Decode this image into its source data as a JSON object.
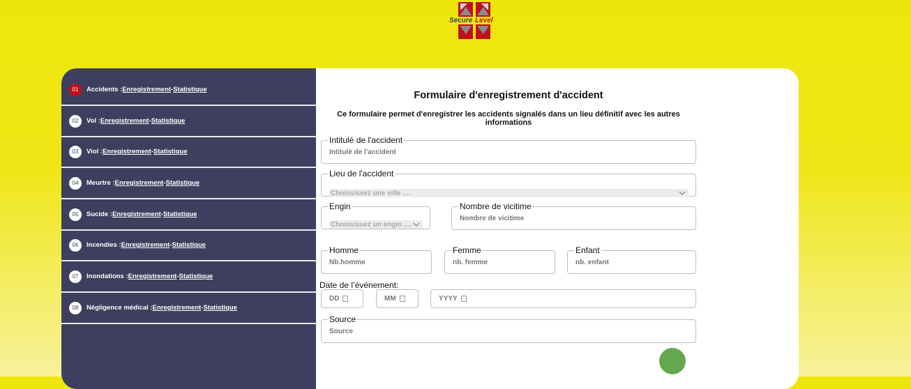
{
  "logo": {
    "text_1": "Secure",
    "text_2": "Level",
    "colors": {
      "red": "#c0101a",
      "grey": "#8a8a8a",
      "text_dark": "#3e3f5e"
    }
  },
  "sidebar": {
    "items": [
      {
        "num": "01",
        "label": "Accidents :",
        "link_1": "Enregistrement",
        "sep": "-",
        "link_2": "Statistique",
        "active": true
      },
      {
        "num": "02",
        "label": "Vol :",
        "link_1": "Enregistrement",
        "sep": "-",
        "link_2": "Statistique"
      },
      {
        "num": "03",
        "label": "Viol :",
        "link_1": "Enregistrement",
        "sep": "-",
        "link_2": "Statistique"
      },
      {
        "num": "04",
        "label": "Meurtre :",
        "link_1": "Enregistrement",
        "sep": "-",
        "link_2": "Statistique"
      },
      {
        "num": "05",
        "label": "Sucide :",
        "link_1": "Enregistrement",
        "sep": "-",
        "link_2": "Statistique"
      },
      {
        "num": "06",
        "label": "Incendies :",
        "link_1": "Enregistrement",
        "sep": "-",
        "link_2": "Statistique"
      },
      {
        "num": "07",
        "label": "Inondations :",
        "link_1": "Enregistrement",
        "sep": "-",
        "link_2": "Statistique"
      },
      {
        "num": "08",
        "label": "Négligence médical :",
        "link_1": "Enregistrement",
        "sep": "-",
        "link_2": "Statistique"
      }
    ]
  },
  "form": {
    "title": "Formulaire d'enregistrement d'accident",
    "description": "Ce formulaire permet d'enregistrer les accidents signalés dans un lieu définitif avec les autres informations",
    "intitule": {
      "legend": "Intitulé de l'accident",
      "placeholder": "Intitulé de l'accident"
    },
    "lieu": {
      "legend": "Lieu de l'accident",
      "selected": "Choississez une ville ...."
    },
    "engin": {
      "legend": "Engin",
      "selected": "Choississez un engin ...."
    },
    "victimes": {
      "legend": "Nombre de vicitime",
      "placeholder": "Nombre de vicitime"
    },
    "homme": {
      "legend": "Homme",
      "placeholder": "Nb.homme"
    },
    "femme": {
      "legend": "Femme",
      "placeholder": "nb. femme"
    },
    "enfant": {
      "legend": "Enfant",
      "placeholder": "nb. enfant"
    },
    "date": {
      "label": "Date de l’événement:",
      "day": "DD",
      "month": "MM",
      "year": "YYYY"
    },
    "source": {
      "legend": "Source",
      "placeholder": "Source"
    }
  },
  "colors": {
    "background": "#eee60a",
    "sidebar": "#3e3f5e",
    "active_badge": "#c0101a",
    "fab": "#65a74f"
  },
  "icons": {
    "select_arrow": "chevron-down-icon",
    "date_picker": "calendar-icon",
    "fab": "submit-button"
  }
}
